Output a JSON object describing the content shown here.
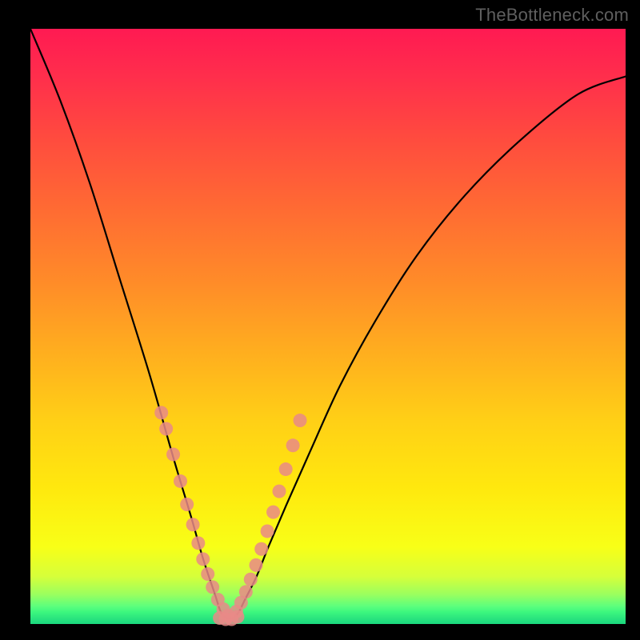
{
  "watermark": "TheBottleneck.com",
  "colors": {
    "gradient_top": "#ff1a52",
    "gradient_mid": "#ffd016",
    "gradient_bottom": "#1ad87e",
    "curve": "#000000",
    "dot": "#e98a87",
    "frame": "#000000"
  },
  "chart_data": {
    "type": "line",
    "title": "",
    "xlabel": "",
    "ylabel": "",
    "xlim": [
      0,
      100
    ],
    "ylim": [
      0,
      100
    ],
    "note": "Axes have no visible tick labels; x and y are expressed as 0–100% of the plot area. y=100 is the top (red), y=0 is the bottom (green). The curve is a V / notch shape with minimum near x≈33.",
    "series": [
      {
        "name": "bottleneck-curve",
        "x": [
          0,
          5,
          10,
          15,
          20,
          24,
          27,
          29,
          31,
          32,
          33,
          34,
          35,
          36,
          38,
          40,
          43,
          47,
          52,
          58,
          65,
          73,
          82,
          92,
          100
        ],
        "y": [
          100,
          88,
          74,
          58,
          42,
          28,
          18,
          11,
          5,
          2,
          1,
          1,
          2,
          4,
          8,
          13,
          20,
          29,
          40,
          51,
          62,
          72,
          81,
          89,
          92
        ]
      }
    ],
    "dots_left_branch": {
      "name": "pink-dots-left",
      "x": [
        22.0,
        22.8,
        24.0,
        25.2,
        26.3,
        27.3,
        28.2,
        29.0,
        29.8,
        30.6,
        31.5,
        32.4,
        33.2
      ],
      "y": [
        35.5,
        32.8,
        28.5,
        24.0,
        20.1,
        16.7,
        13.6,
        10.9,
        8.4,
        6.2,
        4.1,
        2.5,
        1.4
      ]
    },
    "dots_right_branch": {
      "name": "pink-dots-right",
      "x": [
        34.6,
        35.4,
        36.2,
        37.0,
        37.9,
        38.8,
        39.8,
        40.8,
        41.8,
        42.9,
        44.1,
        45.3
      ],
      "y": [
        2.1,
        3.6,
        5.4,
        7.5,
        9.9,
        12.6,
        15.6,
        18.8,
        22.3,
        26.0,
        30.0,
        34.2
      ]
    },
    "dots_bottom": {
      "name": "pink-dots-bottom",
      "x": [
        31.8,
        32.8,
        33.8,
        34.8
      ],
      "y": [
        1.0,
        0.8,
        0.8,
        1.2
      ]
    }
  }
}
